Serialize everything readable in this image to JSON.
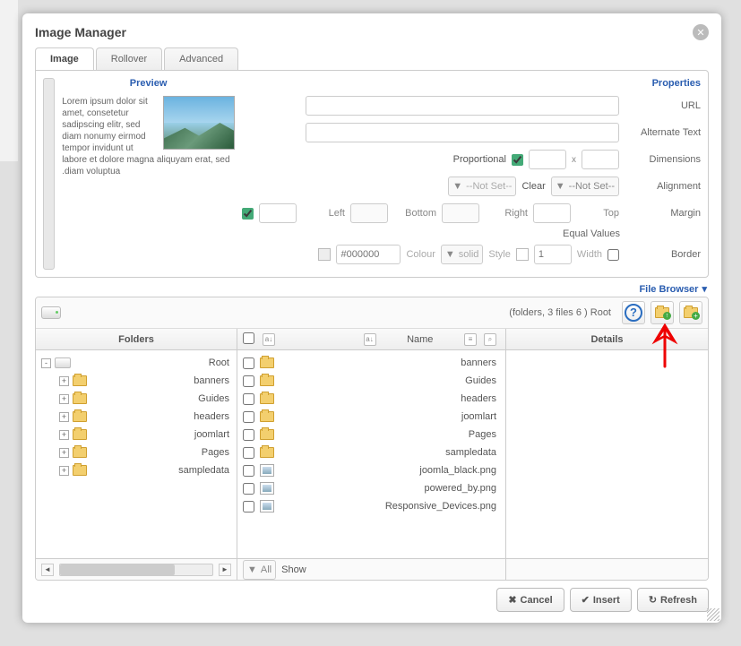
{
  "dialog": {
    "title": "Image Manager"
  },
  "tabs": {
    "image": "Image",
    "rollover": "Rollover",
    "advanced": "Advanced"
  },
  "preview": {
    "title": "Preview",
    "lorem": "Lorem ipsum dolor sit amet, consetetur sadipscing elitr, sed diam nonumy eirmod tempor invidunt ut labore et dolore magna aliquyam erat, sed .diam voluptua"
  },
  "props": {
    "title": "Properties",
    "url": "URL",
    "alt": "Alternate Text",
    "dimensions": "Dimensions",
    "proportional": "Proportional",
    "alignment": "Alignment",
    "notset": "--Not Set--",
    "clear": "Clear",
    "margin": "Margin",
    "left": "Left",
    "bottom": "Bottom",
    "right": "Right",
    "top": "Top",
    "equal": "Equal Values",
    "border": "Border",
    "colorval": "#000000",
    "colour": "Colour",
    "solid": "solid",
    "style": "Style",
    "one": "1",
    "width": "Width"
  },
  "filebrowser": {
    "label": "File Browser",
    "crumb": "(folders, 3 files 6 ) Root",
    "folders_head": "Folders",
    "name_head": "Name",
    "details_head": "Details",
    "show": "Show",
    "all": "All",
    "tree": [
      {
        "label": "Root",
        "toggle": "-",
        "icon": "drive",
        "indent": 0
      },
      {
        "label": "banners",
        "toggle": "+",
        "icon": "folder",
        "indent": 1
      },
      {
        "label": "Guides",
        "toggle": "+",
        "icon": "folder",
        "indent": 1
      },
      {
        "label": "headers",
        "toggle": "+",
        "icon": "folder",
        "indent": 1
      },
      {
        "label": "joomlart",
        "toggle": "+",
        "icon": "folder",
        "indent": 1
      },
      {
        "label": "Pages",
        "toggle": "+",
        "icon": "folder",
        "indent": 1
      },
      {
        "label": "sampledata",
        "toggle": "+",
        "icon": "folder",
        "indent": 1
      }
    ],
    "files": [
      {
        "label": "banners",
        "type": "folder"
      },
      {
        "label": "Guides",
        "type": "folder"
      },
      {
        "label": "headers",
        "type": "folder"
      },
      {
        "label": "joomlart",
        "type": "folder"
      },
      {
        "label": "Pages",
        "type": "folder"
      },
      {
        "label": "sampledata",
        "type": "folder"
      },
      {
        "label": "joomla_black.png",
        "type": "img"
      },
      {
        "label": "powered_by.png",
        "type": "img"
      },
      {
        "label": "Responsive_Devices.png",
        "type": "img"
      }
    ]
  },
  "buttons": {
    "cancel": "Cancel",
    "insert": "Insert",
    "refresh": "Refresh"
  }
}
